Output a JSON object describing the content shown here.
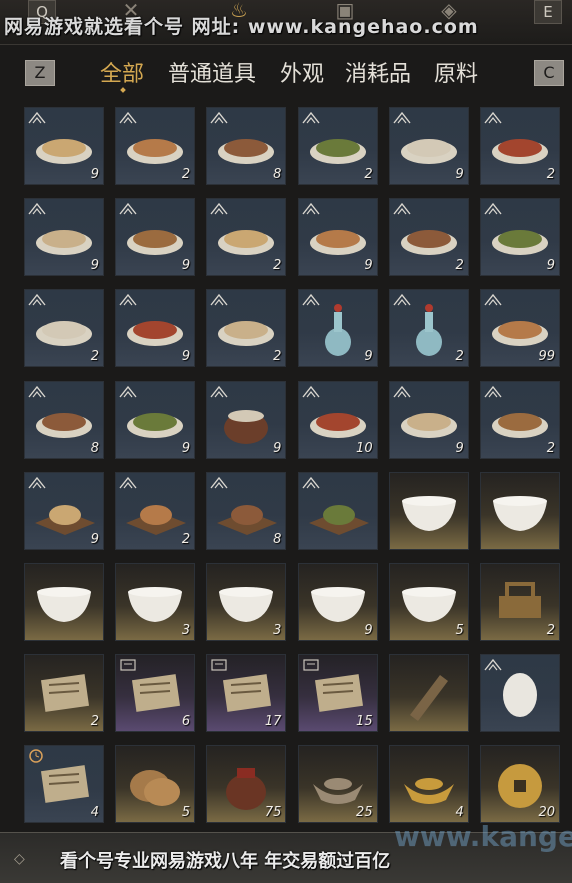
{
  "header": {
    "keys": {
      "left": "Q",
      "right": "E"
    },
    "watermark": "网易游戏就选看个号  网址: www.kangehao.com"
  },
  "tabs": {
    "left_key": "Z",
    "right_key": "C",
    "items": [
      "全部",
      "普通道具",
      "外观",
      "消耗品",
      "原料"
    ],
    "active_index": 0
  },
  "accent_color": "#d4a851",
  "items": [
    {
      "name": "noodle-bowl-icon",
      "count": "9",
      "tag": true,
      "bg": "blue"
    },
    {
      "name": "noodle-bowl-icon",
      "count": "2",
      "tag": true,
      "bg": "blue"
    },
    {
      "name": "porridge-bowl-icon",
      "count": "8",
      "tag": true,
      "bg": "blue"
    },
    {
      "name": "soup-bowl-icon",
      "count": "2",
      "tag": true,
      "bg": "blue"
    },
    {
      "name": "berry-dish-icon",
      "count": "9",
      "tag": true,
      "bg": "blue"
    },
    {
      "name": "wine-cup-icon",
      "count": "2",
      "tag": true,
      "bg": "blue"
    },
    {
      "name": "sliced-meat-plate-icon",
      "count": "9",
      "tag": true,
      "bg": "blue"
    },
    {
      "name": "fried-meat-plate-icon",
      "count": "9",
      "tag": true,
      "bg": "blue"
    },
    {
      "name": "greens-plate-icon",
      "count": "2",
      "tag": true,
      "bg": "blue"
    },
    {
      "name": "stew-bowl-icon",
      "count": "9",
      "tag": true,
      "bg": "blue"
    },
    {
      "name": "clear-soup-bowl-icon",
      "count": "2",
      "tag": true,
      "bg": "blue"
    },
    {
      "name": "dumpling-plate-icon",
      "count": "9",
      "tag": true,
      "bg": "blue"
    },
    {
      "name": "braised-dish-icon",
      "count": "2",
      "tag": true,
      "bg": "blue"
    },
    {
      "name": "noodle-bowl-icon",
      "count": "9",
      "tag": true,
      "bg": "blue"
    },
    {
      "name": "rice-congee-icon",
      "count": "2",
      "tag": true,
      "bg": "blue"
    },
    {
      "name": "porcelain-vase-icon",
      "count": "9",
      "tag": true,
      "bg": "blue"
    },
    {
      "name": "porcelain-vase-icon",
      "count": "2",
      "tag": true,
      "bg": "blue"
    },
    {
      "name": "fried-noodle-plate-icon",
      "count": "99",
      "tag": true,
      "bg": "blue"
    },
    {
      "name": "mushroom-plate-icon",
      "count": "8",
      "tag": true,
      "bg": "blue"
    },
    {
      "name": "chili-bowl-icon",
      "count": "9",
      "tag": true,
      "bg": "blue"
    },
    {
      "name": "clay-pot-icon",
      "count": "9",
      "tag": true,
      "bg": "blue"
    },
    {
      "name": "pork-belly-plate-icon",
      "count": "10",
      "tag": true,
      "bg": "blue"
    },
    {
      "name": "tofu-bowl-icon",
      "count": "9",
      "tag": true,
      "bg": "blue"
    },
    {
      "name": "meatball-plate-icon",
      "count": "2",
      "tag": true,
      "bg": "blue"
    },
    {
      "name": "fried-snack-board-icon",
      "count": "9",
      "tag": true,
      "bg": "blue"
    },
    {
      "name": "cake-board-icon",
      "count": "2",
      "tag": true,
      "bg": "blue"
    },
    {
      "name": "pastry-stack-icon",
      "count": "8",
      "tag": true,
      "bg": "blue"
    },
    {
      "name": "bun-board-icon",
      "count": "",
      "tag": true,
      "bg": "blue"
    },
    {
      "name": "porcelain-bowl-icon",
      "count": "",
      "tag": false,
      "bg": "gold"
    },
    {
      "name": "porcelain-bowl-icon",
      "count": "",
      "tag": false,
      "bg": "gold"
    },
    {
      "name": "painted-bowl-icon",
      "count": "",
      "tag": false,
      "bg": "gold"
    },
    {
      "name": "white-bowl-icon",
      "count": "3",
      "tag": false,
      "bg": "gold"
    },
    {
      "name": "lidded-bowl-icon",
      "count": "3",
      "tag": false,
      "bg": "gold"
    },
    {
      "name": "porcelain-plate-icon",
      "count": "9",
      "tag": false,
      "bg": "gold"
    },
    {
      "name": "blue-rim-bowl-icon",
      "count": "5",
      "tag": false,
      "bg": "gold"
    },
    {
      "name": "bronze-lock-icon",
      "count": "2",
      "tag": false,
      "bg": "gold"
    },
    {
      "name": "wooden-tablet-icon",
      "count": "2",
      "tag": false,
      "bg": "gold"
    },
    {
      "name": "recipe-scroll-icon",
      "count": "6",
      "tag": "scroll",
      "bg": "purple"
    },
    {
      "name": "recipe-scroll-icon",
      "count": "17",
      "tag": "scroll",
      "bg": "purple"
    },
    {
      "name": "recipe-scroll-icon",
      "count": "15",
      "tag": "scroll",
      "bg": "purple"
    },
    {
      "name": "carpenter-square-icon",
      "count": "",
      "tag": false,
      "bg": "gold"
    },
    {
      "name": "egg-icon",
      "count": "",
      "tag": true,
      "bg": "blue"
    },
    {
      "name": "booklet-icon",
      "count": "4",
      "tag": "clock",
      "bg": "blue"
    },
    {
      "name": "flatbread-icon",
      "count": "5",
      "tag": false,
      "bg": "gold"
    },
    {
      "name": "wine-jar-icon",
      "count": "75",
      "tag": false,
      "bg": "gold"
    },
    {
      "name": "silver-ingot-icon",
      "count": "25",
      "tag": false,
      "bg": "gold"
    },
    {
      "name": "gold-ingot-icon",
      "count": "4",
      "tag": false,
      "bg": "gold"
    },
    {
      "name": "copper-coin-icon",
      "count": "20",
      "tag": false,
      "bg": "gold"
    }
  ],
  "footer": {
    "watermark": "看个号专业网易游戏八年  年交易额过百亿",
    "domain_text": "www.kangehao.com"
  }
}
